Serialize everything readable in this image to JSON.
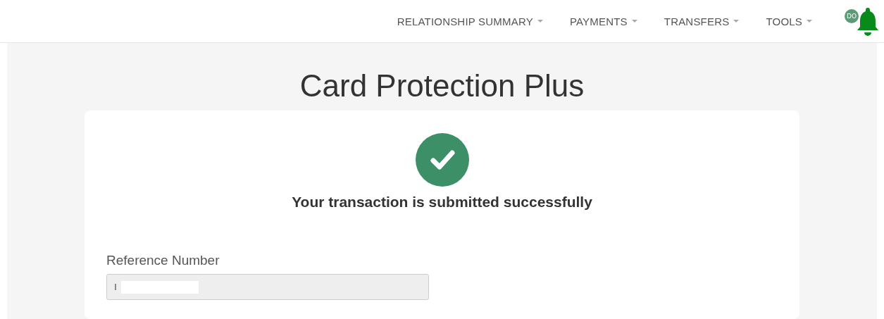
{
  "nav": {
    "items": [
      {
        "label": "RELATIONSHIP SUMMARY"
      },
      {
        "label": "PAYMENTS"
      },
      {
        "label": "TRANSFERS"
      },
      {
        "label": "TOOLS"
      }
    ],
    "avatar": "DO"
  },
  "page": {
    "title": "Card Protection Plus"
  },
  "card": {
    "success": true,
    "message": "Your transaction is submitted successfully",
    "reference": {
      "label": "Reference Number",
      "value": "I",
      "disabled": true
    }
  }
}
